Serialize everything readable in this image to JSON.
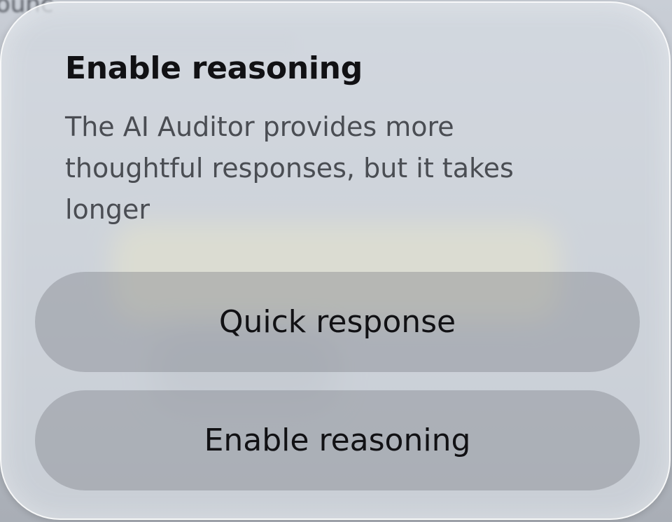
{
  "background": {
    "partial_text": "ounc"
  },
  "dialog": {
    "title": "Enable reasoning",
    "message": "The AI Auditor provides more thoughtful responses, but it takes longer",
    "buttons": {
      "quick_response": "Quick response",
      "enable_reasoning": "Enable reasoning"
    }
  },
  "colors": {
    "sheet_background": "#d6dbe2",
    "button_background": "#8a8e96",
    "title_text": "#111114",
    "message_text": "#4a4d53"
  }
}
